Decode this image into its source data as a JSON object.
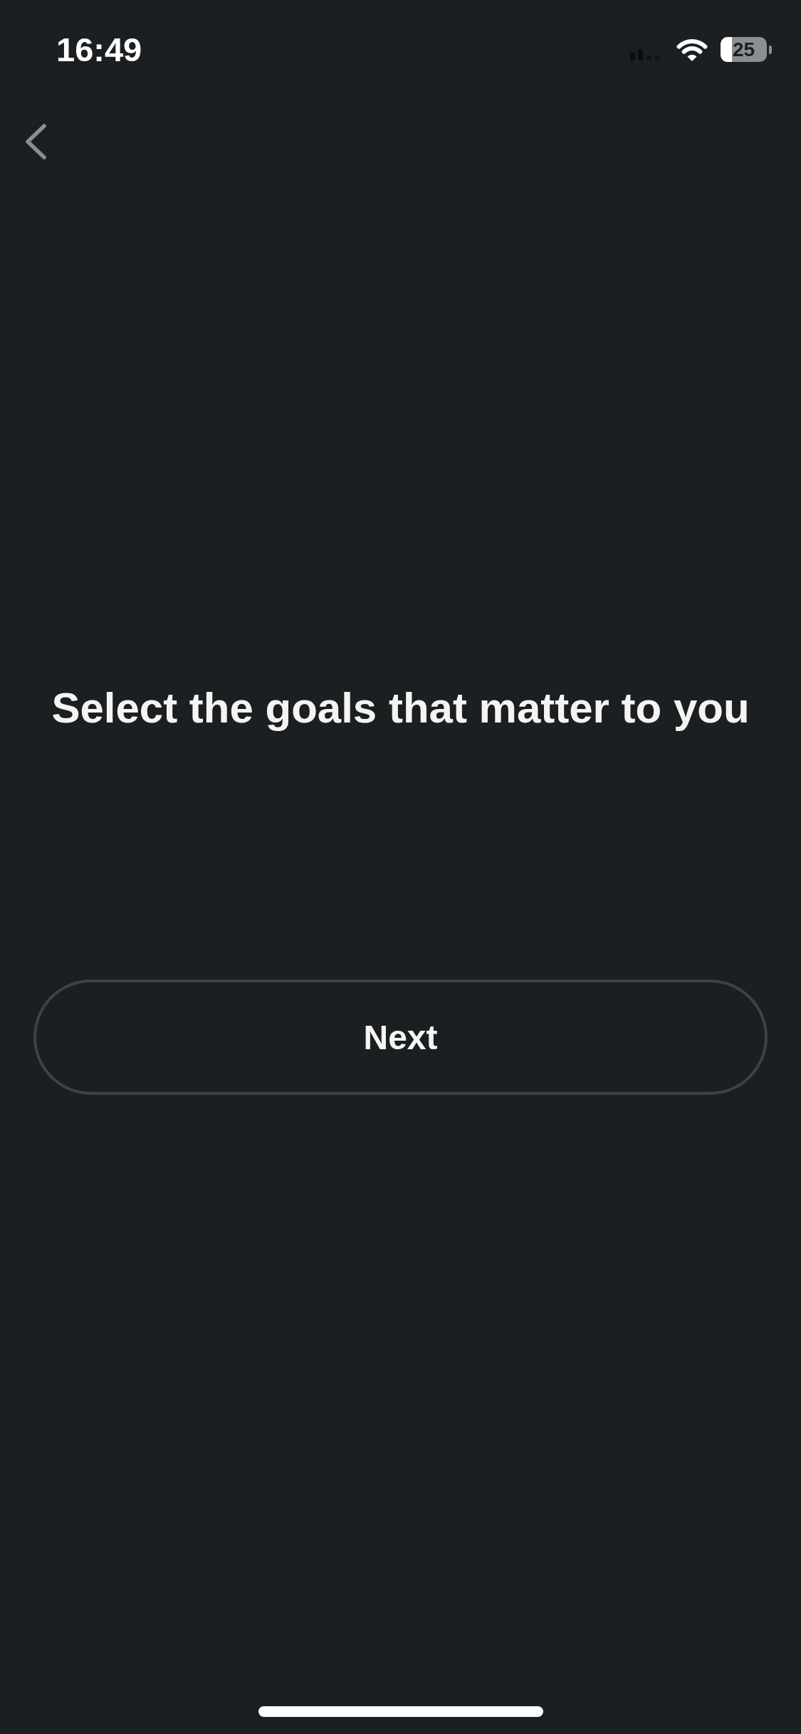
{
  "status_bar": {
    "time": "16:49",
    "battery": {
      "level": 0.25,
      "reading": "25"
    }
  },
  "title": "Select the goals that matter to you",
  "next_button": {
    "label": "Next"
  }
}
